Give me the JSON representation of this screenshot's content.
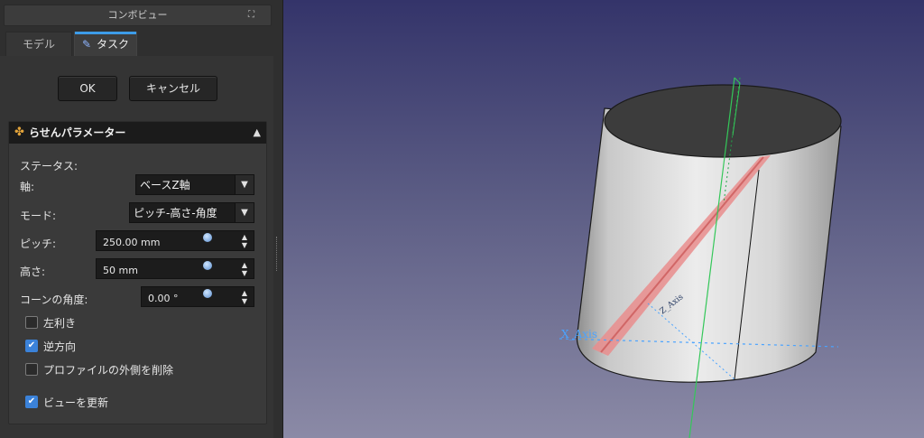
{
  "panel": {
    "title": "コンボビュー",
    "float_icon": "⛶",
    "tabs": [
      {
        "label": "モデル"
      },
      {
        "label": "タスク",
        "icon": "pencil-icon"
      }
    ]
  },
  "dialog": {
    "ok_label": "OK",
    "cancel_label": "キャンセル"
  },
  "group": {
    "title": "らせんパラメーター",
    "status_label": "ステータス:",
    "axis_label": "軸:",
    "axis_value": "ベースZ軸",
    "mode_label": "モード:",
    "mode_value": "ピッチ-高さ-角度",
    "pitch_label": "ピッチ:",
    "pitch_value": "250.00 mm",
    "height_label": "高さ:",
    "height_value": "50 mm",
    "angle_label": "コーンの角度:",
    "angle_value": "0.00 °",
    "left_handed_label": "左利き",
    "left_handed_checked": false,
    "reversed_label": "逆方向",
    "reversed_checked": true,
    "remove_outside_label": "プロファイルの外側を削除",
    "remove_outside_checked": false,
    "update_view_label": "ビューを更新",
    "update_view_checked": true
  },
  "viewport": {
    "x_axis_label": "X_Axis",
    "z_axis_label": "Z_Axis",
    "colors": {
      "cylinder_body": "#d7d7d7",
      "cylinder_top": "#3a3a3a",
      "helix": "#e98d8d",
      "x_axis": "#4aa3ff",
      "y_axis": "#34c759"
    }
  }
}
